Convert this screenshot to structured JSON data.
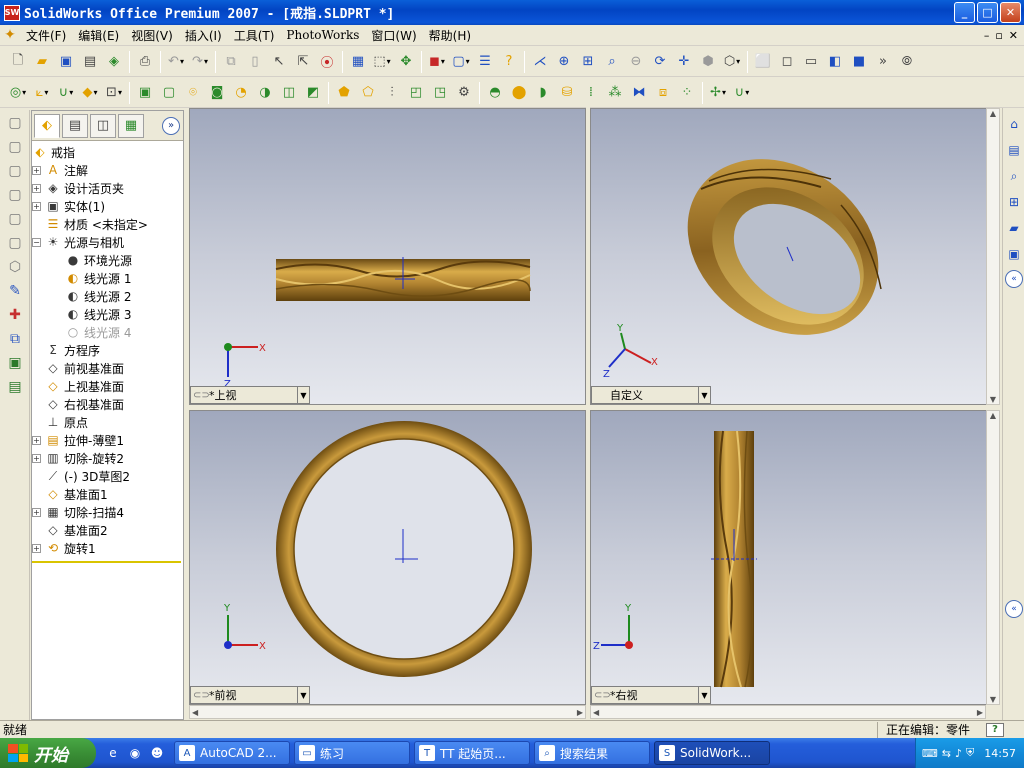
{
  "window": {
    "title": "SolidWorks Office Premium 2007 - [戒指.SLDPRT *]",
    "app_icon": "SW",
    "min": "_",
    "max": "□",
    "close": "✕"
  },
  "menu": {
    "items": [
      "文件(F)",
      "编辑(E)",
      "视图(V)",
      "插入(I)",
      "工具(T)",
      "PhotoWorks",
      "窗口(W)",
      "帮助(H)"
    ],
    "doc_controls": [
      "–",
      "▫",
      "✕"
    ]
  },
  "tree": {
    "root": "戒指",
    "nodes": [
      {
        "label": "注解",
        "icon": "A",
        "expand": "+"
      },
      {
        "label": "设计活页夹",
        "icon": "◈",
        "expand": "+"
      },
      {
        "label": "实体(1)",
        "icon": "▣",
        "expand": "+"
      },
      {
        "label": "材质 <未指定>",
        "icon": "☰",
        "expand": ""
      },
      {
        "label": "光源与相机",
        "icon": "☀",
        "expand": "−"
      },
      {
        "label": "环境光源",
        "icon": "●",
        "expand": "",
        "indent": 1
      },
      {
        "label": "线光源 1",
        "icon": "◐",
        "expand": "",
        "indent": 1
      },
      {
        "label": "线光源 2",
        "icon": "◐",
        "expand": "",
        "indent": 1
      },
      {
        "label": "线光源 3",
        "icon": "◐",
        "expand": "",
        "indent": 1
      },
      {
        "label": "线光源 4",
        "icon": "○",
        "expand": "",
        "indent": 1,
        "dim": true
      },
      {
        "label": "方程序",
        "icon": "Σ",
        "expand": ""
      },
      {
        "label": "前视基准面",
        "icon": "◇",
        "expand": ""
      },
      {
        "label": "上视基准面",
        "icon": "◇",
        "expand": ""
      },
      {
        "label": "右视基准面",
        "icon": "◇",
        "expand": ""
      },
      {
        "label": "原点",
        "icon": "⊥",
        "expand": ""
      },
      {
        "label": "拉伸-薄壁1",
        "icon": "▤",
        "expand": "+"
      },
      {
        "label": "切除-旋转2",
        "icon": "▥",
        "expand": "+"
      },
      {
        "label": "(-) 3D草图2",
        "icon": "⟋",
        "expand": ""
      },
      {
        "label": "基准面1",
        "icon": "◇",
        "expand": ""
      },
      {
        "label": "切除-扫描4",
        "icon": "▦",
        "expand": "+"
      },
      {
        "label": "基准面2",
        "icon": "◇",
        "expand": ""
      },
      {
        "label": "旋转1",
        "icon": "⟲",
        "expand": "+"
      }
    ]
  },
  "viewports": {
    "top": "*上视",
    "custom": "自定义",
    "front": "*前视",
    "right": "*右视"
  },
  "axes": {
    "x": "X",
    "y": "Y",
    "z": "Z"
  },
  "colors": {
    "gold": "#b98a2c",
    "gold_dark": "#6e4d12",
    "gold_light": "#e3bd5a",
    "axis_x": "#cc2020",
    "axis_y": "#1e8a1e",
    "axis_z": "#1e2ec8"
  },
  "status": {
    "left": "就绪",
    "editing": "正在编辑：零件",
    "help": "?"
  },
  "taskbar": {
    "start": "开始",
    "tasks": [
      {
        "label": "AutoCAD 2...",
        "icon": "A"
      },
      {
        "label": "练习",
        "icon": "▭"
      },
      {
        "label": "TT 起始页...",
        "icon": "T"
      },
      {
        "label": "搜索结果",
        "icon": "⌕"
      },
      {
        "label": "SolidWork...",
        "icon": "S",
        "active": true
      }
    ],
    "clock": "14:57"
  }
}
